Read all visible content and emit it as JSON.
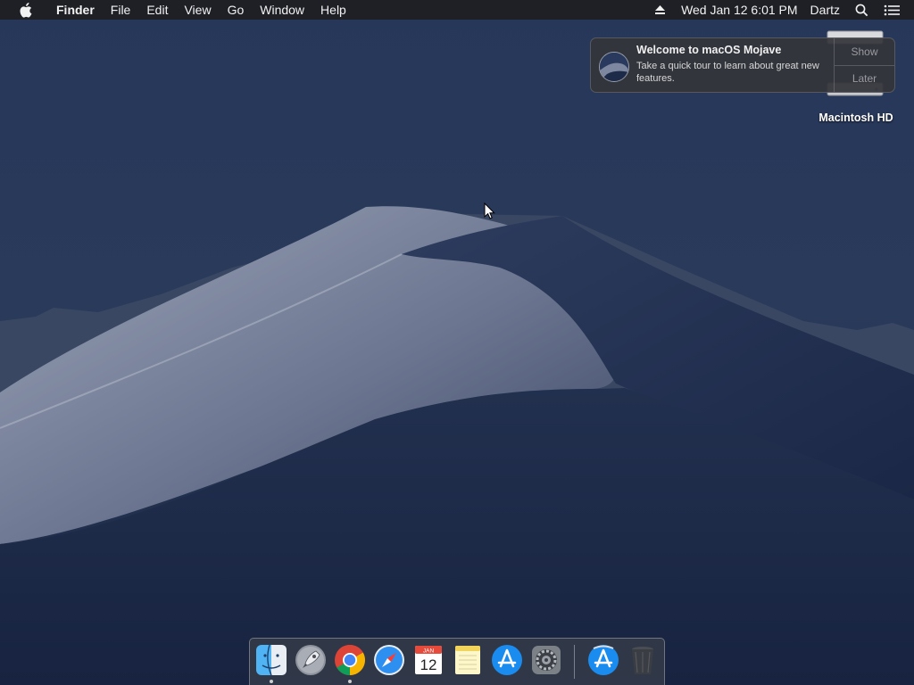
{
  "menubar": {
    "app_name": "Finder",
    "menus": [
      "File",
      "Edit",
      "View",
      "Go",
      "Window",
      "Help"
    ],
    "datetime": "Wed Jan 12  6:01 PM",
    "user": "Dartz"
  },
  "notification": {
    "title": "Welcome to macOS Mojave",
    "body": "Take a quick tour to learn about great new features.",
    "show_label": "Show",
    "later_label": "Later"
  },
  "desktop": {
    "drive_label": "Macintosh HD"
  },
  "dock": {
    "apps": [
      {
        "name": "Finder",
        "icon": "finder-icon",
        "running": true
      },
      {
        "name": "Launchpad",
        "icon": "launchpad-icon",
        "running": false
      },
      {
        "name": "Google Chrome",
        "icon": "chrome-icon",
        "running": true
      },
      {
        "name": "Safari",
        "icon": "safari-icon",
        "running": false
      },
      {
        "name": "Calendar",
        "icon": "calendar-icon",
        "running": false,
        "month": "JAN",
        "day": "12"
      },
      {
        "name": "Notes",
        "icon": "notes-icon",
        "running": false
      },
      {
        "name": "App Store",
        "icon": "app-store-icon",
        "running": false
      },
      {
        "name": "System Preferences",
        "icon": "system-preferences-icon",
        "running": false
      },
      {
        "name": "Downloads",
        "icon": "downloads-app-store-icon",
        "running": false
      },
      {
        "name": "Trash",
        "icon": "trash-icon",
        "running": false
      }
    ]
  },
  "colors": {
    "sky": "#1c2a44",
    "dune_light": "#8e96a8",
    "dune_dark": "#1e2b48",
    "menubar": "#1e1e22"
  }
}
